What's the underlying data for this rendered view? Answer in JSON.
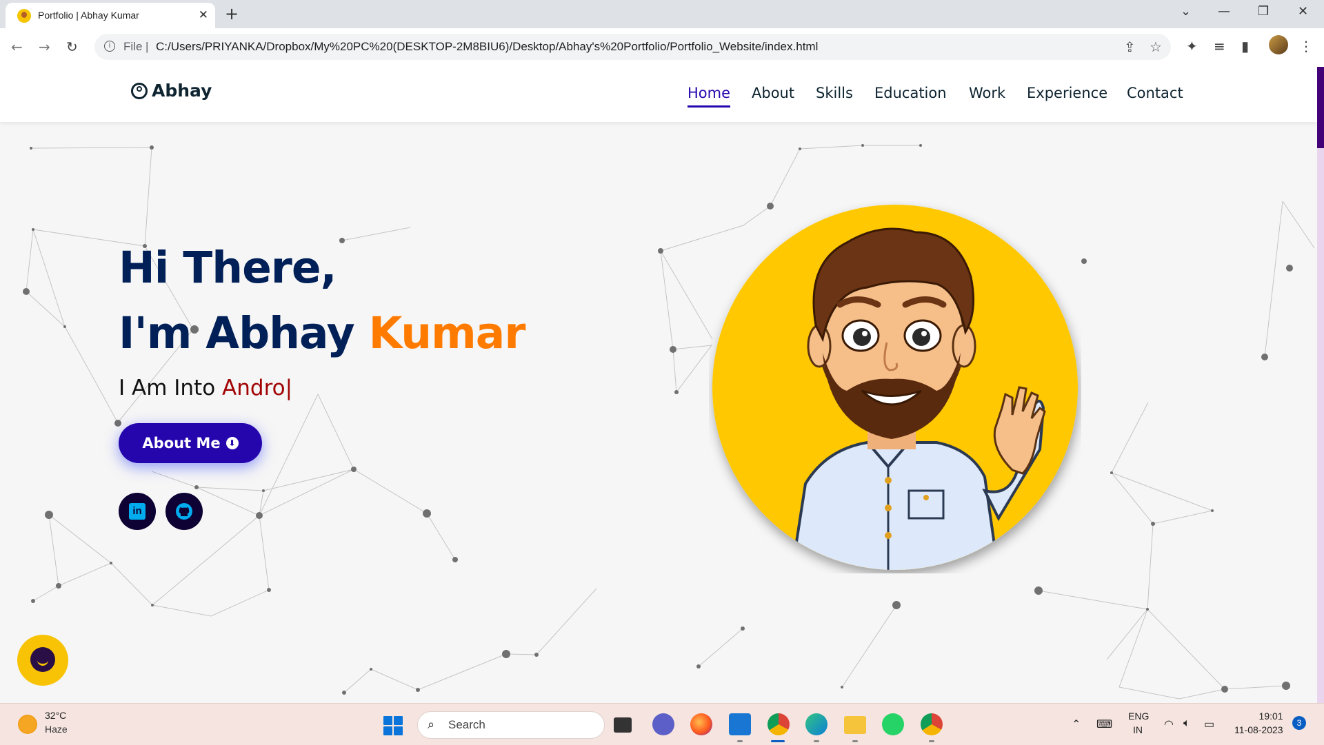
{
  "browser": {
    "tab_title": "Portfolio | Abhay Kumar",
    "tab_close": "✕",
    "new_tab": "+",
    "scheme_label": "File",
    "url": "C:/Users/PRIYANKA/Dropbox/My%20PC%20(DESKTOP-2M8BIU6)/Desktop/Abhay's%20Portfolio/Portfolio_Website/index.html"
  },
  "site": {
    "logo": "Abhay",
    "nav": [
      "Home",
      "About",
      "Skills",
      "Education",
      "Work",
      "Experience",
      "Contact"
    ],
    "active_nav": "Home"
  },
  "hero": {
    "greeting": "Hi There,",
    "name_prefix": "I'm Abhay",
    "name_highlight": "Kumar",
    "intro_prefix": "I Am Into",
    "intro_typed": "Andro|",
    "about_button": "About Me",
    "socials": [
      "linkedin-icon",
      "github-icon"
    ]
  },
  "colors": {
    "nav_active": "#2506ad",
    "heading": "#002057",
    "highlight": "#ff7b00",
    "typed": "#a10404",
    "button": "#2506ad",
    "avatar_bg": "#ffc800"
  },
  "taskbar": {
    "temperature": "32°C",
    "weather": "Haze",
    "search_placeholder": "Search",
    "language": "ENG",
    "region": "IN",
    "time": "19:01",
    "date": "11-08-2023",
    "notifications": "3"
  }
}
